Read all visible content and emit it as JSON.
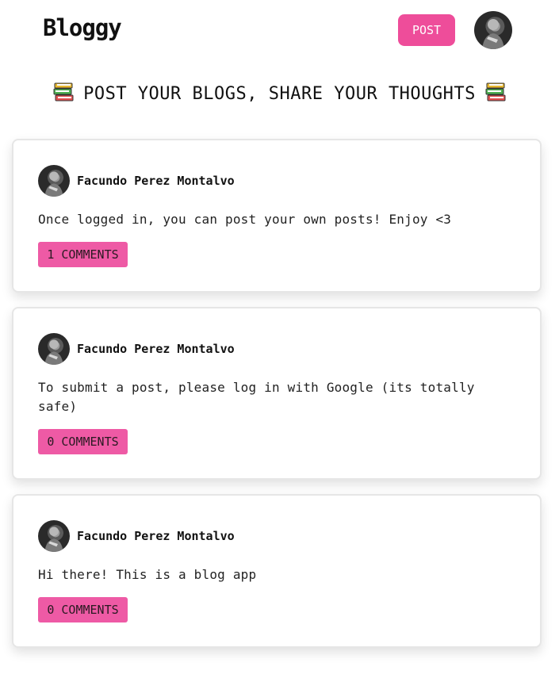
{
  "header": {
    "brand": "Bloggy",
    "post_button": "POST",
    "avatar_icon": "user-avatar-photo"
  },
  "tagline": {
    "text": "POST YOUR BLOGS, SHARE YOUR THOUGHTS",
    "icon": "books-icon"
  },
  "colors": {
    "accent": "#ee4d9a",
    "comment_badge": "#ee5aa5"
  },
  "posts": [
    {
      "author": "Facundo Perez Montalvo",
      "body": "Once logged in, you can post your own posts! Enjoy <3",
      "comments": "1 COMMENTS"
    },
    {
      "author": "Facundo Perez Montalvo",
      "body": "To submit a post, please log in with Google (its totally safe)",
      "comments": "0 COMMENTS"
    },
    {
      "author": "Facundo Perez Montalvo",
      "body": "Hi there! This is a blog app",
      "comments": "0 COMMENTS"
    }
  ]
}
